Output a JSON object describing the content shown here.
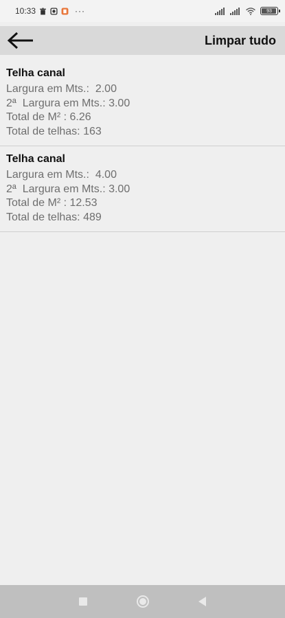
{
  "status_bar": {
    "time": "10:33",
    "dots": "···",
    "battery_level": "93"
  },
  "toolbar": {
    "back_icon": "arrow-left-icon",
    "clear_all_label": "Limpar tudo"
  },
  "items": [
    {
      "title": "Telha canal",
      "lines": [
        "Largura em Mts.:  2.00",
        "2ª  Largura em Mts.: 3.00",
        "Total de M² : 6.26",
        "Total de telhas: 163"
      ]
    },
    {
      "title": "Telha canal",
      "lines": [
        "Largura em Mts.:  4.00",
        "2ª  Largura em Mts.: 3.00",
        "Total de M² : 12.53",
        "Total de telhas: 489"
      ]
    }
  ],
  "nav_bar": {
    "recents_icon": "square-icon",
    "home_icon": "circle-icon",
    "back_icon": "triangle-back-icon"
  }
}
